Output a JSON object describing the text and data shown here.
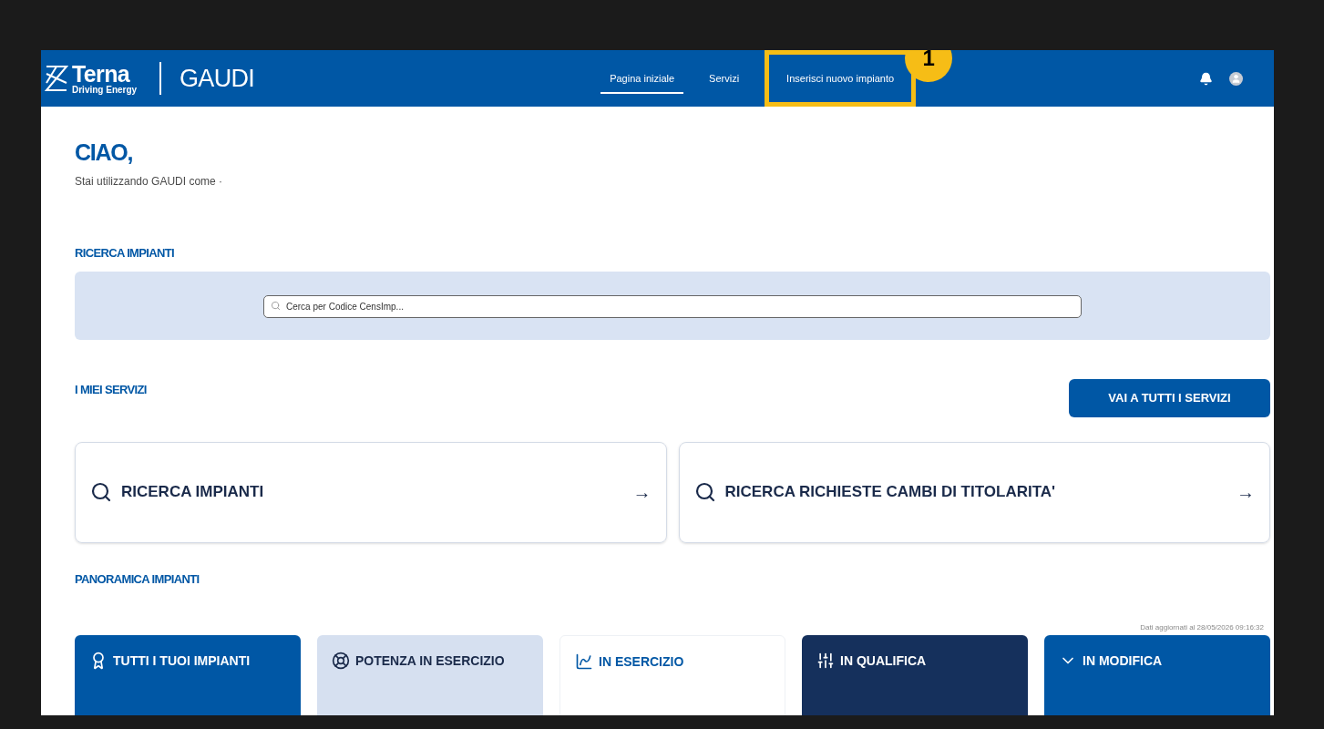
{
  "header": {
    "brand": "Terna",
    "brand_tagline": "Driving Energy",
    "app_name": "GAUDI",
    "nav": [
      {
        "label": "Pagina iniziale",
        "selected": true,
        "highlighted": false
      },
      {
        "label": "Servizi",
        "selected": false,
        "highlighted": false
      },
      {
        "label": "Inserisci nuovo impianto",
        "selected": false,
        "highlighted": true
      }
    ],
    "callout": "1"
  },
  "greeting": {
    "title": "CIAO,",
    "subtitle": "Stai utilizzando GAUDI come ·"
  },
  "search_section": {
    "title": "RICERCA IMPIANTI",
    "placeholder": "Cerca per Codice CensImp..."
  },
  "services": {
    "title": "I MIEI SERVIZI",
    "button": "VAI A TUTTI I SERVIZI",
    "cards": [
      {
        "label": "RICERCA IMPIANTI",
        "arrow": "→"
      },
      {
        "label": "RICERCA RICHIESTE CAMBI DI TITOLARITA'",
        "arrow": "→"
      }
    ]
  },
  "overview": {
    "title": "PANORAMICA IMPIANTI",
    "updated": "Dati aggiornati al 28/05/2026 09:16:32",
    "tiles": [
      {
        "kind": "blue",
        "label": "TUTTI I TUOI IMPIANTI"
      },
      {
        "kind": "light",
        "label": "POTENZA IN ESERCIZIO"
      },
      {
        "kind": "white",
        "label": "IN ESERCIZIO"
      },
      {
        "kind": "navy",
        "label": "IN QUALIFICA"
      },
      {
        "kind": "blue",
        "label": "IN MODIFICA"
      }
    ]
  }
}
